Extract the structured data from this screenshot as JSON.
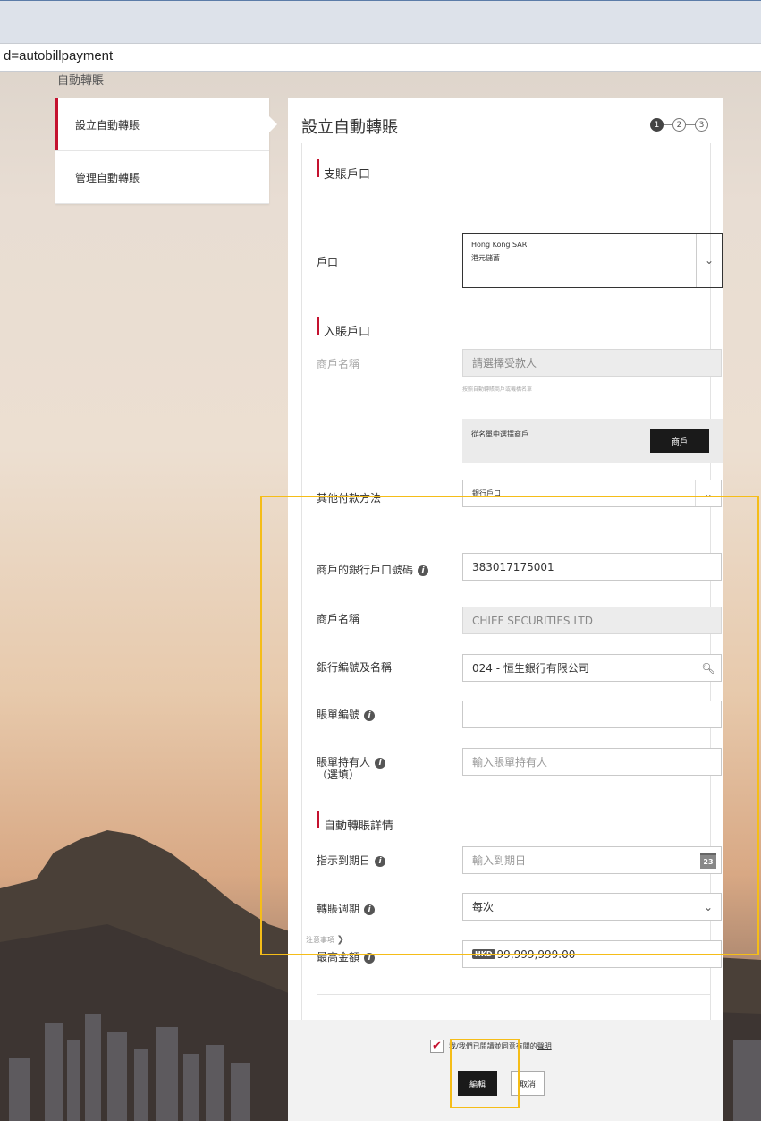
{
  "browser": {
    "url_fragment": "d=autobillpayment"
  },
  "page": {
    "crumb": "自動轉賬"
  },
  "sidebar": {
    "items": [
      {
        "label": "設立自動轉賬",
        "active": true
      },
      {
        "label": "管理自動轉賬",
        "active": false
      }
    ]
  },
  "panel": {
    "title": "設立自動轉賬",
    "steps": [
      "1",
      "2",
      "3"
    ],
    "current_step": 1
  },
  "debit": {
    "heading": "支賬戶口",
    "account_label": "戶口",
    "account_line1": "Hong Kong SAR",
    "account_line2": "港元儲蓄"
  },
  "credit": {
    "heading": "入賬戶口",
    "merchant_label": "商戶名稱",
    "merchant_placeholder": "請選擇受款人",
    "merchant_hint": "按照自動轉賬商戶或機構名單",
    "pick_text": "從名單中選擇商戶",
    "pick_button": "商戶",
    "other_method_label": "其他付款方法",
    "other_method_value": "銀行戶口"
  },
  "bank": {
    "account_no_label": "商戶的銀行戶口號碼",
    "account_no_value": "383017175001",
    "merchant_name_label": "商戶名稱",
    "merchant_name_value": "CHIEF SECURITIES LTD",
    "bank_code_label": "銀行編號及名稱",
    "bank_code_value": "024 - 恒生銀行有限公司",
    "bill_no_label": "賬單編號",
    "bill_no_value": "",
    "bill_holder_label": "賬單持有人",
    "bill_holder_optional": "（選填）",
    "bill_holder_placeholder": "輸入賬單持有人"
  },
  "details": {
    "heading": "自動轉賬詳情",
    "expiry_label": "指示到期日",
    "expiry_placeholder": "輸入到期日",
    "calendar_day": "23",
    "frequency_label": "轉賬週期",
    "frequency_value": "每次",
    "max_label": "最高金額",
    "currency": "HKD",
    "max_value": "99,999,999.00"
  },
  "notes": {
    "link": "注意事項"
  },
  "footer": {
    "agree_text": "我/我們已閱讀並同意有關的",
    "agree_link": "聲明",
    "checked": true,
    "edit_button": "編輯",
    "cancel_button": "取消"
  },
  "colors": {
    "accent_red": "#c4122f",
    "highlight": "#f5bd18",
    "button_dark": "#1a1a1a"
  }
}
